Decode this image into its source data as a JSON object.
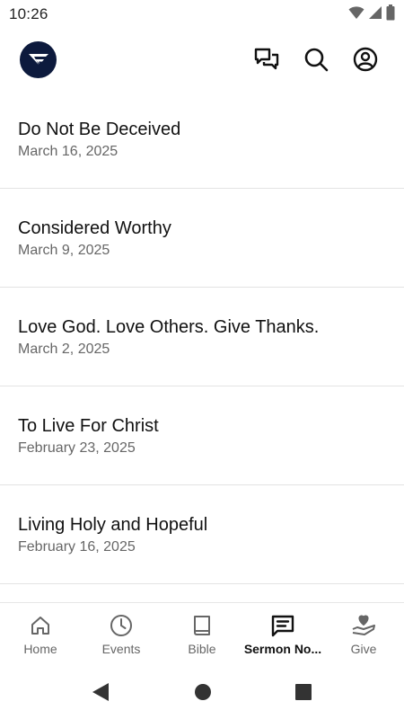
{
  "status_bar": {
    "time": "10:26",
    "icons": [
      "wifi-icon",
      "signal-icon",
      "battery-icon"
    ]
  },
  "app_bar": {
    "logo": "church-logo",
    "actions": [
      "chat-icon",
      "search-icon",
      "account-icon"
    ]
  },
  "sermons": [
    {
      "title": "Do Not Be Deceived",
      "date": "March 16, 2025"
    },
    {
      "title": "Considered Worthy",
      "date": "March 9, 2025"
    },
    {
      "title": "Love God. Love Others. Give Thanks.",
      "date": "March 2, 2025"
    },
    {
      "title": "To Live For Christ",
      "date": "February 23, 2025"
    },
    {
      "title": "Living Holy and Hopeful",
      "date": "February 16, 2025"
    }
  ],
  "bottom_nav": {
    "active": "Sermon No...",
    "items": [
      {
        "label": "Home",
        "icon": "home-icon"
      },
      {
        "label": "Events",
        "icon": "clock-icon"
      },
      {
        "label": "Bible",
        "icon": "book-icon"
      },
      {
        "label": "Sermon No...",
        "icon": "notes-icon"
      },
      {
        "label": "Give",
        "icon": "give-icon"
      }
    ]
  },
  "system_nav": [
    "back-icon",
    "home-circle-icon",
    "recents-icon"
  ],
  "colors": {
    "logo_bg": "#0d1a3d",
    "text_primary": "#111111",
    "text_secondary": "#666666",
    "divider": "#e3e3e3"
  }
}
